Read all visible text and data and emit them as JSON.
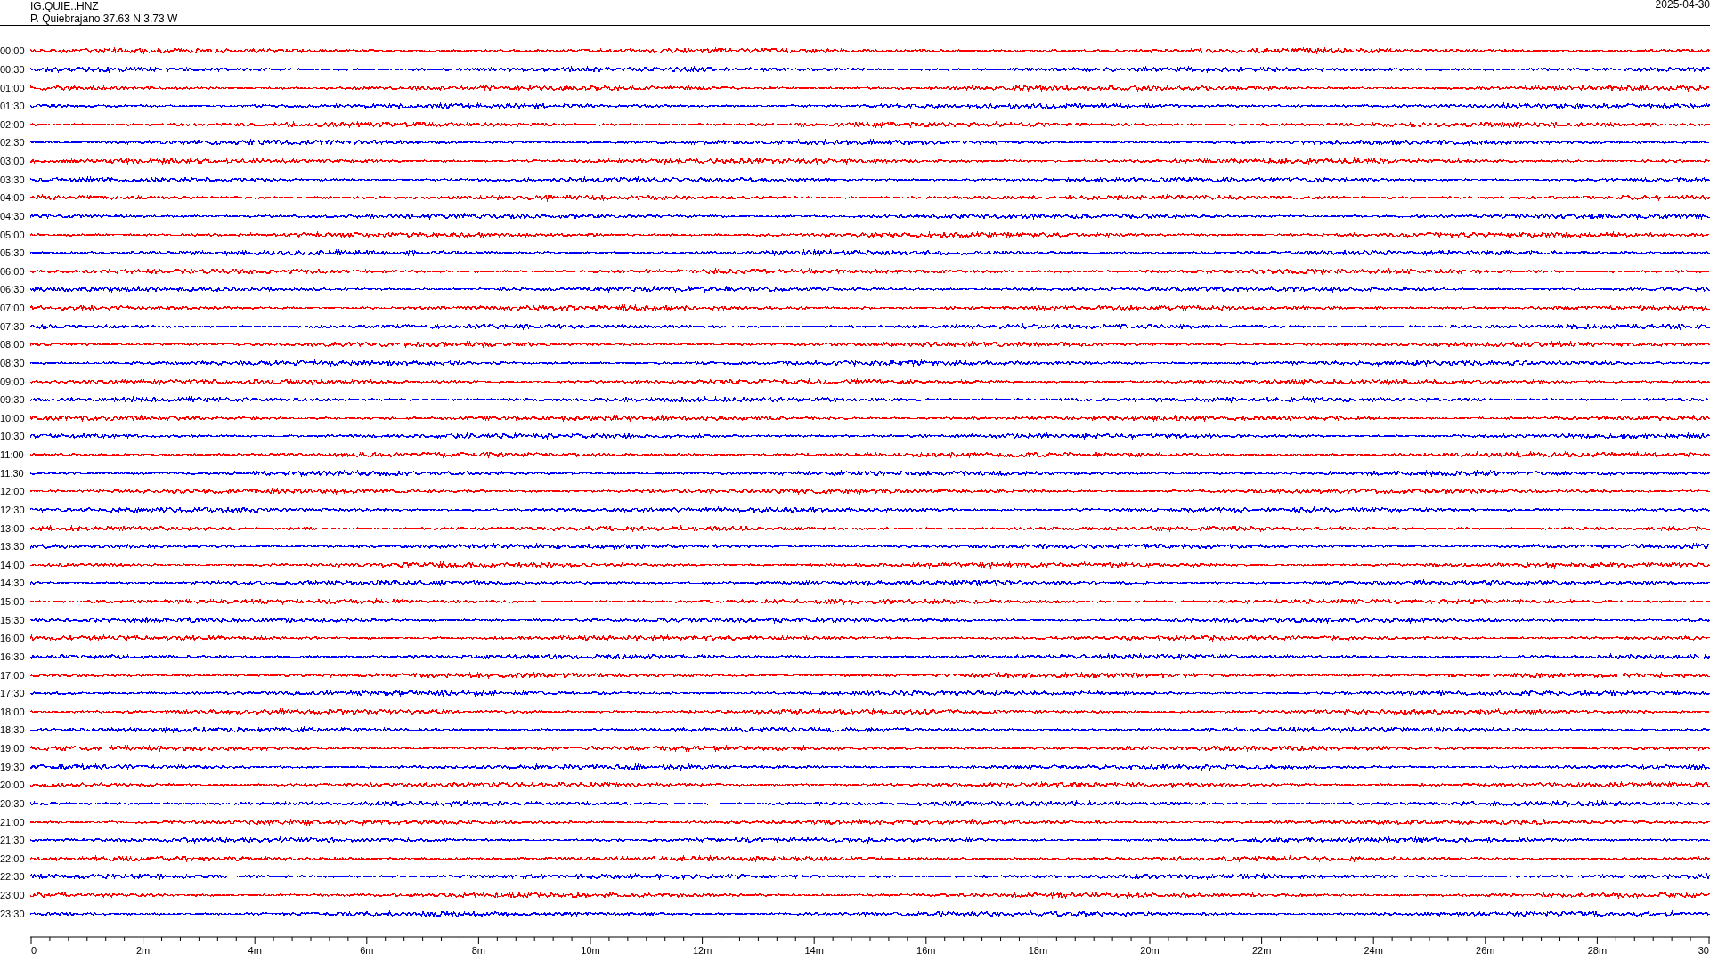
{
  "header": {
    "station": "IG.QUIE..HNZ",
    "location": "P. Quiebrajano  37.63 N 3.73 W",
    "date": "2025-04-30"
  },
  "rows": [
    {
      "time": "00:00",
      "color": "#ff0000"
    },
    {
      "time": "00:30",
      "color": "#0000ff"
    },
    {
      "time": "01:00",
      "color": "#ff0000"
    },
    {
      "time": "01:30",
      "color": "#0000ff"
    },
    {
      "time": "02:00",
      "color": "#ff0000"
    },
    {
      "time": "02:30",
      "color": "#0000ff"
    },
    {
      "time": "03:00",
      "color": "#ff0000"
    },
    {
      "time": "03:30",
      "color": "#0000ff"
    },
    {
      "time": "04:00",
      "color": "#ff0000"
    },
    {
      "time": "04:30",
      "color": "#0000ff"
    },
    {
      "time": "05:00",
      "color": "#ff0000"
    },
    {
      "time": "05:30",
      "color": "#0000ff"
    },
    {
      "time": "06:00",
      "color": "#ff0000"
    },
    {
      "time": "06:30",
      "color": "#0000ff"
    },
    {
      "time": "07:00",
      "color": "#ff0000"
    },
    {
      "time": "07:30",
      "color": "#0000ff"
    },
    {
      "time": "08:00",
      "color": "#ff0000"
    },
    {
      "time": "08:30",
      "color": "#0000ff"
    },
    {
      "time": "09:00",
      "color": "#ff0000"
    },
    {
      "time": "09:30",
      "color": "#0000ff"
    },
    {
      "time": "10:00",
      "color": "#ff0000"
    },
    {
      "time": "10:30",
      "color": "#0000ff"
    },
    {
      "time": "11:00",
      "color": "#ff0000"
    },
    {
      "time": "11:30",
      "color": "#0000ff"
    },
    {
      "time": "12:00",
      "color": "#ff0000"
    },
    {
      "time": "12:30",
      "color": "#0000ff"
    },
    {
      "time": "13:00",
      "color": "#ff0000"
    },
    {
      "time": "13:30",
      "color": "#0000ff"
    },
    {
      "time": "14:00",
      "color": "#ff0000"
    },
    {
      "time": "14:30",
      "color": "#0000ff"
    },
    {
      "time": "15:00",
      "color": "#ff0000"
    },
    {
      "time": "15:30",
      "color": "#0000ff"
    },
    {
      "time": "16:00",
      "color": "#ff0000"
    },
    {
      "time": "16:30",
      "color": "#0000ff"
    },
    {
      "time": "17:00",
      "color": "#ff0000"
    },
    {
      "time": "17:30",
      "color": "#0000ff"
    },
    {
      "time": "18:00",
      "color": "#ff0000"
    },
    {
      "time": "18:30",
      "color": "#0000ff"
    },
    {
      "time": "19:00",
      "color": "#ff0000"
    },
    {
      "time": "19:30",
      "color": "#0000ff"
    },
    {
      "time": "20:00",
      "color": "#ff0000"
    },
    {
      "time": "20:30",
      "color": "#0000ff"
    },
    {
      "time": "21:00",
      "color": "#ff0000"
    },
    {
      "time": "21:30",
      "color": "#0000ff"
    },
    {
      "time": "22:00",
      "color": "#ff0000"
    },
    {
      "time": "22:30",
      "color": "#0000ff"
    },
    {
      "time": "23:00",
      "color": "#ff0000"
    },
    {
      "time": "23:30",
      "color": "#0000ff"
    }
  ],
  "x_axis": {
    "labels": [
      "0",
      "2m",
      "4m",
      "6m",
      "8m",
      "10m",
      "12m",
      "14m",
      "16m",
      "18m",
      "20m",
      "22m",
      "24m",
      "26m",
      "28m",
      "30"
    ]
  }
}
